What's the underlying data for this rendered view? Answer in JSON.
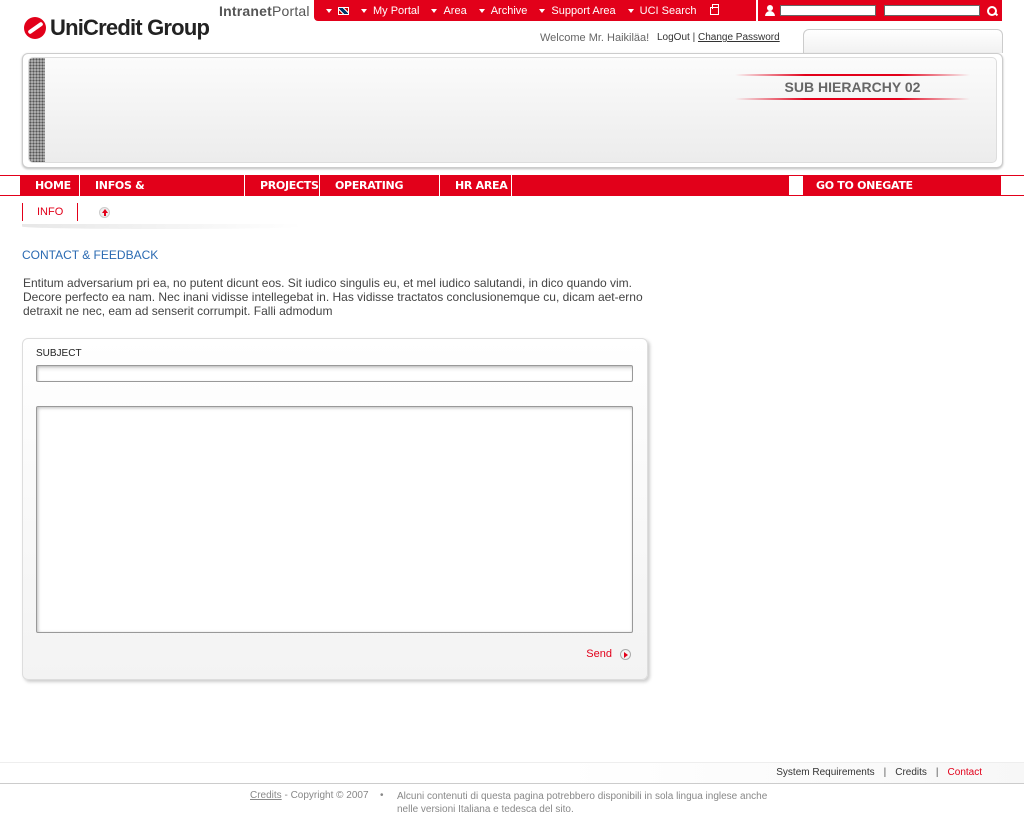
{
  "brand": {
    "name": "UniCredit Group",
    "portal_prefix": "Intranet",
    "portal_suffix": "Portal"
  },
  "topnav": {
    "items": [
      {
        "label": "My Portal"
      },
      {
        "label": "Area"
      },
      {
        "label": "Archive"
      },
      {
        "label": "Support Area"
      },
      {
        "label": "UCI Search"
      }
    ]
  },
  "welcome": {
    "text": "Welcome Mr. Haikiläa!",
    "logout": "LogOut",
    "separator": "|",
    "change_password": "Change Password"
  },
  "banner": {
    "title": "SUB HIERARCHY 02"
  },
  "mainnav": {
    "items": [
      {
        "label": "HOME",
        "width": 60
      },
      {
        "label": "INFOS & COMMUNICATIONS",
        "width": 165
      },
      {
        "label": "PROJECTS",
        "width": 75
      },
      {
        "label": "OPERATING TOOLS",
        "width": 120
      },
      {
        "label": "HR AREA",
        "width": 72
      }
    ],
    "goto": "GO TO ONEGATE"
  },
  "subnav": {
    "item": "INFO"
  },
  "content": {
    "title": "CONTACT & FEEDBACK",
    "intro": "Entitum adversarium pri ea, no putent dicunt eos. Sit iudico singulis eu, et mel iudico salutandi, in dico quando vim. Decore perfecto ea nam. Nec inani vidisse intellegebat in. Has vidisse tractatos conclusionemque cu, dicam aet-erno detraxit ne nec, eam ad senserit corrumpit. Falli admodum"
  },
  "form": {
    "subject_label": "SUBJECT",
    "subject_value": "",
    "message_value": "",
    "send": "Send"
  },
  "footer": {
    "links": [
      "System Requirements",
      "Credits",
      "Contact"
    ],
    "separator": "|",
    "credits_link": "Credits",
    "copyright": " - Copyright © 2007",
    "bullet": "•",
    "note": "Alcuni contenuti di questa pagina potrebbero disponibili in sola lingua inglese anche nelle versioni Italiana e tedesca del sito."
  },
  "colors": {
    "brand_red": "#e2001a",
    "title_blue": "#2a6ab2"
  }
}
